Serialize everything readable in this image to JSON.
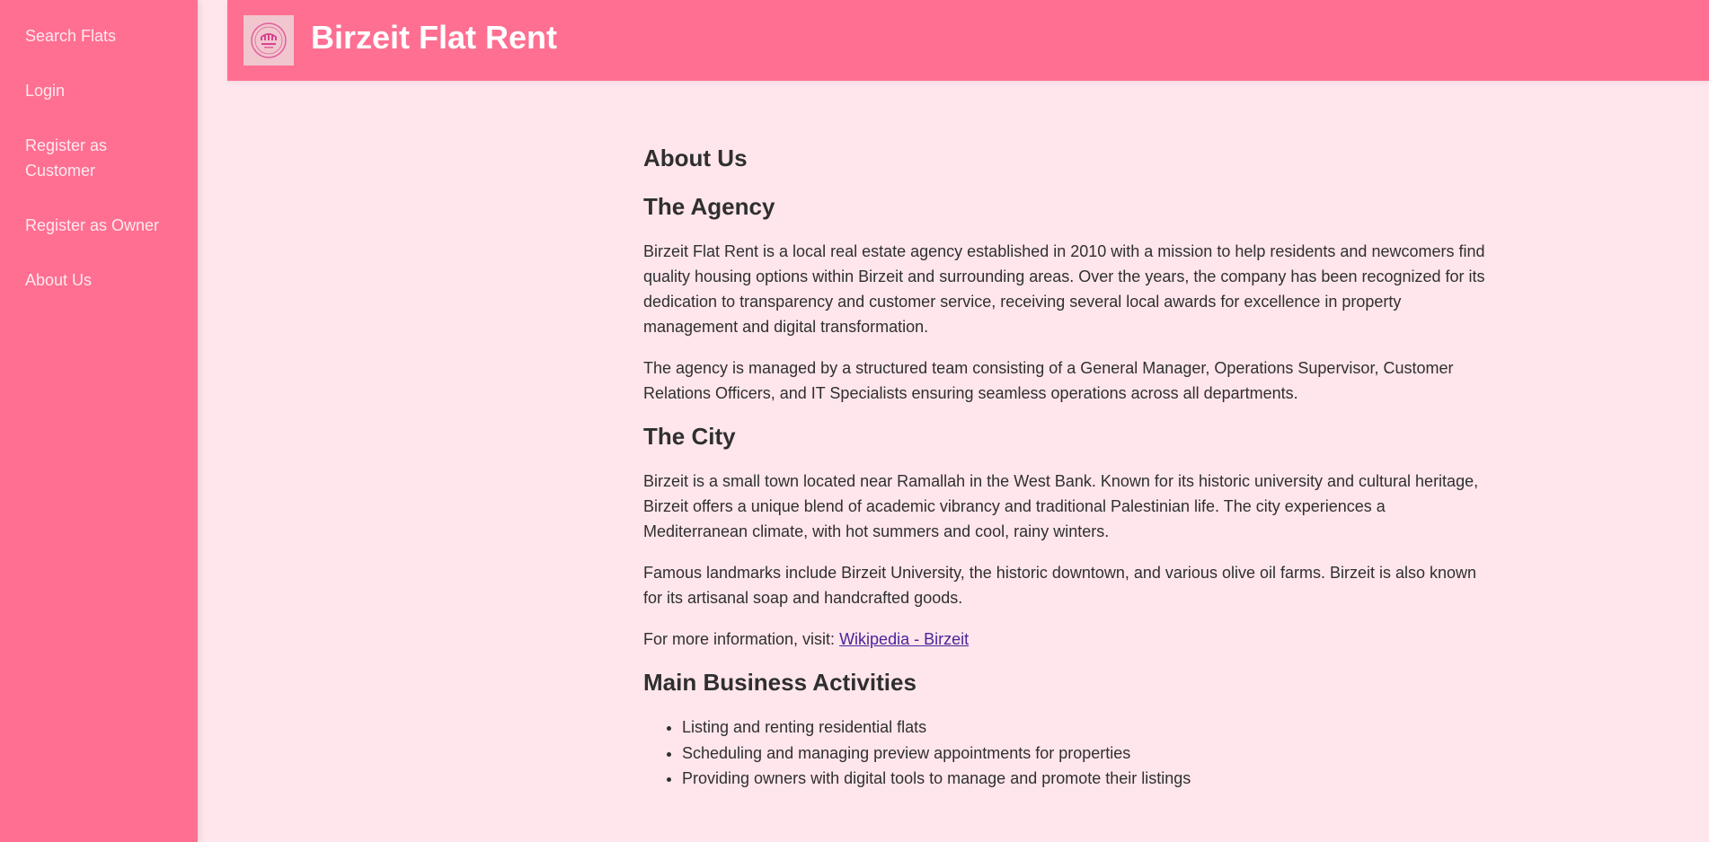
{
  "sidebar": {
    "items": [
      {
        "label": "Search Flats"
      },
      {
        "label": "Login"
      },
      {
        "label": "Register as Customer"
      },
      {
        "label": "Register as Owner"
      },
      {
        "label": "About Us"
      }
    ]
  },
  "header": {
    "title": "Birzeit Flat Rent",
    "logo_icon": "agency-logo-icon"
  },
  "main": {
    "page_heading": "About Us",
    "agency": {
      "heading": "The Agency",
      "p1": "Birzeit Flat Rent is a local real estate agency established in 2010 with a mission to help residents and newcomers find quality housing options within Birzeit and surrounding areas. Over the years, the company has been recognized for its dedication to transparency and customer service, receiving several local awards for excellence in property management and digital transformation.",
      "p2": "The agency is managed by a structured team consisting of a General Manager, Operations Supervisor, Customer Relations Officers, and IT Specialists ensuring seamless operations across all departments."
    },
    "city": {
      "heading": "The City",
      "p1": "Birzeit is a small town located near Ramallah in the West Bank. Known for its historic university and cultural heritage, Birzeit offers a unique blend of academic vibrancy and traditional Palestinian life. The city experiences a Mediterranean climate, with hot summers and cool, rainy winters.",
      "p2": "Famous landmarks include Birzeit University, the historic downtown, and various olive oil farms. Birzeit is also known for its artisanal soap and handcrafted goods.",
      "more_info_prefix": "For more information, visit: ",
      "more_info_link": "Wikipedia - Birzeit"
    },
    "activities": {
      "heading": "Main Business Activities",
      "items": [
        "Listing and renting residential flats",
        "Scheduling and managing preview appointments for properties",
        "Providing owners with digital tools to manage and promote their listings"
      ]
    }
  },
  "colors": {
    "accent": "#ff6f91",
    "background": "#ffe6ec",
    "link": "#4b2399"
  }
}
